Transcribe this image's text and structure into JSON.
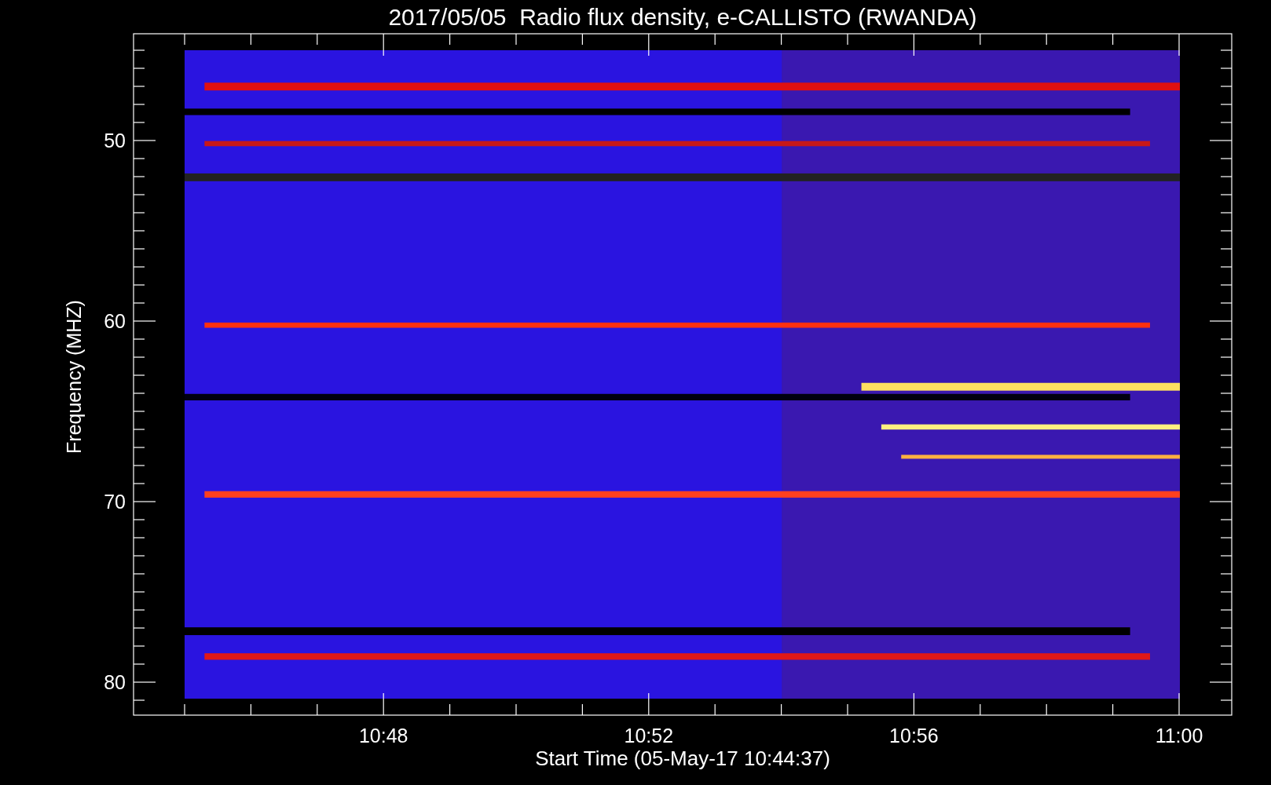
{
  "title": "2017/05/05  Radio flux density, e-CALLISTO (RWANDA)",
  "y_axis": {
    "label": "Frequency (MHZ)",
    "ticks": [
      "50",
      "60",
      "70",
      "80"
    ]
  },
  "x_axis": {
    "label": "Start Time (05-May-17 10:44:37)",
    "ticks": [
      "10:48",
      "10:52",
      "10:56",
      "11:00"
    ]
  }
}
